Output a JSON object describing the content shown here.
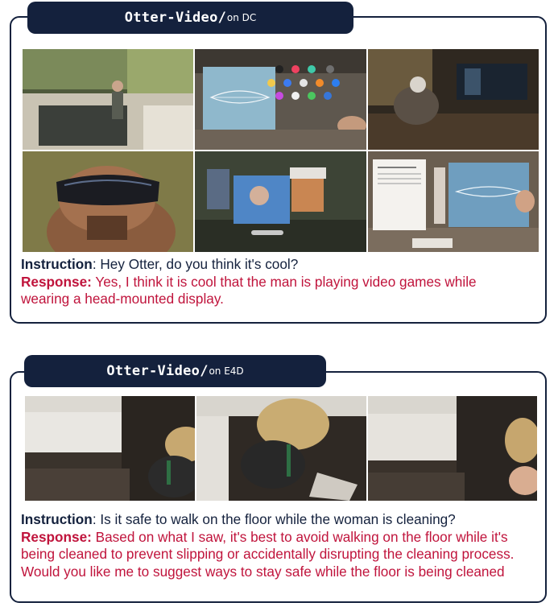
{
  "panels": [
    {
      "model_name": "Otter-Video",
      "separator": "/",
      "source": "on DC",
      "instruction_label": "Instruction",
      "instruction_text": ": Hey Otter, do you think it's cool?",
      "response_label": "Response:",
      "response_text": " Yes, I think it is cool that the man is playing video games while wearing a head-mounted display."
    },
    {
      "model_name": "Otter-Video",
      "separator": "/",
      "source": "on E4D",
      "instruction_label": "Instruction",
      "instruction_text": ": Is it safe to walk on the floor while the woman is cleaning?",
      "response_label": "Response:",
      "response_text": " Based on what I saw, it's best to avoid walking on the floor while it's being cleaned to prevent slipping or accidentally disrupting the cleaning process. Would you like me to suggest ways to stay safe while the floor is being cleaned"
    }
  ],
  "colors": {
    "frame": "#14213d",
    "response": "#c0143c",
    "instruction": "#14213d"
  }
}
